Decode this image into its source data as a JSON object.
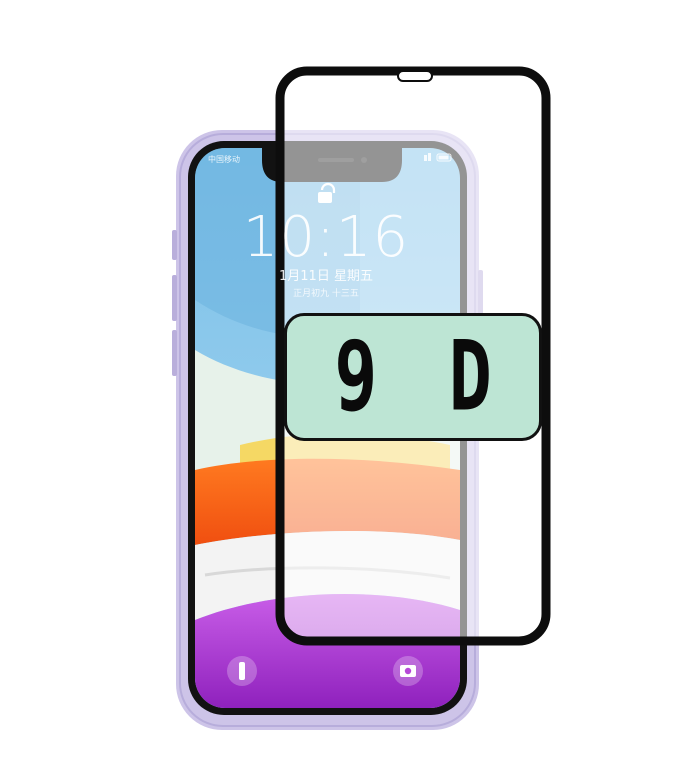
{
  "product": {
    "badge_label": "9 D",
    "lock_screen": {
      "time": "10:16",
      "date": "1月11日 星期五",
      "subtitle": "正月初九 十三五"
    },
    "status_bar_left": "中国移动"
  },
  "colors": {
    "badge_fill": "#bde5d4",
    "phone_frame": "#c9c0e6",
    "screen_blue": "#8ec8ea",
    "wave_orange": "#f56a1c",
    "wave_purple": "#b03bd6",
    "glass_border": "#111111"
  },
  "icons": [
    "lock-icon",
    "flashlight-icon",
    "camera-icon"
  ]
}
